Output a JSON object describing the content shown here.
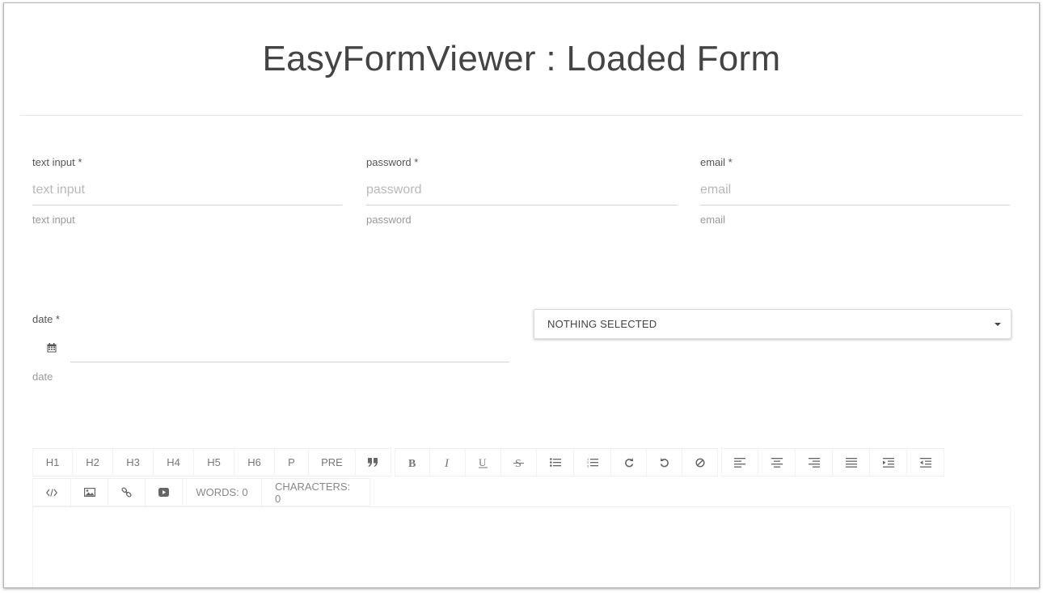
{
  "page": {
    "title": "EasyFormViewer : Loaded Form"
  },
  "fields": {
    "text_input": {
      "label": "text input *",
      "placeholder": "text input",
      "value": "",
      "help": "text input"
    },
    "password": {
      "label": "password *",
      "placeholder": "password",
      "value": "",
      "help": "password"
    },
    "email": {
      "label": "email *",
      "placeholder": "email",
      "value": "",
      "help": "email"
    },
    "date": {
      "label": "date *",
      "value": "",
      "help": "date",
      "icon": "calendar-icon"
    }
  },
  "select": {
    "selected": "NOTHING SELECTED",
    "icon": "caret-down-icon"
  },
  "editor": {
    "headings": [
      "H1",
      "H2",
      "H3",
      "H4",
      "H5",
      "H6",
      "P",
      "PRE"
    ],
    "quote_icon": "quote-icon",
    "format_icons": [
      "bold-icon",
      "italic-icon",
      "underline-icon",
      "strikethrough-icon",
      "bullet-list-icon",
      "numbered-list-icon",
      "redo-icon",
      "undo-icon",
      "clear-format-icon"
    ],
    "align_icons": [
      "align-left-icon",
      "align-center-icon",
      "align-right-icon",
      "align-justify-icon",
      "indent-icon",
      "outdent-icon"
    ],
    "insert_icons": [
      "html-code-icon",
      "image-icon",
      "link-icon",
      "video-icon"
    ],
    "words_label": "WORDS: 0",
    "characters_label": "CHARACTERS: 0",
    "content": ""
  }
}
